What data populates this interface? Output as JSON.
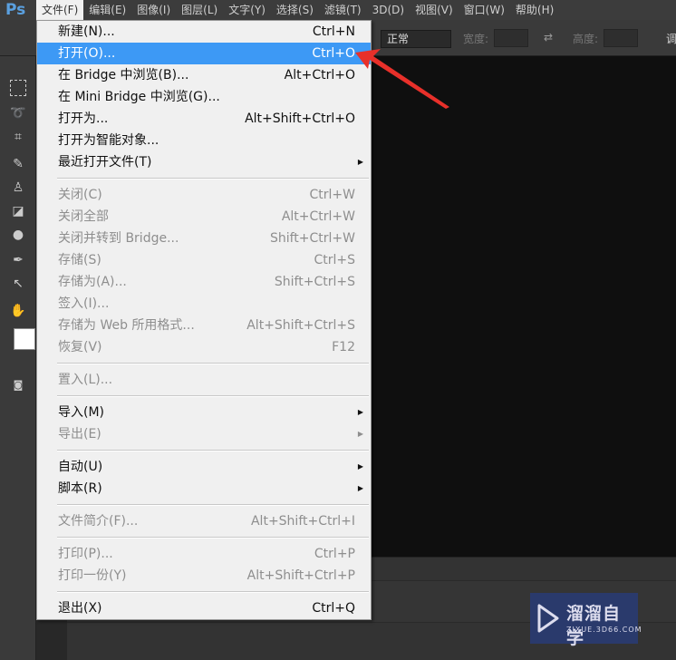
{
  "app_logo": "Ps",
  "menubar": [
    "文件(F)",
    "编辑(E)",
    "图像(I)",
    "图层(L)",
    "文字(Y)",
    "选择(S)",
    "滤镜(T)",
    "3D(D)",
    "视图(V)",
    "窗口(W)",
    "帮助(H)"
  ],
  "options": {
    "mode": "正常",
    "width_label": "宽度:",
    "height_label": "高度:",
    "trailing": "调"
  },
  "file_menu": [
    [
      {
        "label": "新建(N)...",
        "shortcut": "Ctrl+N"
      },
      {
        "label": "打开(O)...",
        "shortcut": "Ctrl+O",
        "highlighted": true
      },
      {
        "label": "在 Bridge 中浏览(B)...",
        "shortcut": "Alt+Ctrl+O"
      },
      {
        "label": "在 Mini Bridge 中浏览(G)..."
      },
      {
        "label": "打开为...",
        "shortcut": "Alt+Shift+Ctrl+O"
      },
      {
        "label": "打开为智能对象..."
      },
      {
        "label": "最近打开文件(T)",
        "submenu": true
      }
    ],
    [
      {
        "label": "关闭(C)",
        "shortcut": "Ctrl+W",
        "disabled": true
      },
      {
        "label": "关闭全部",
        "shortcut": "Alt+Ctrl+W",
        "disabled": true
      },
      {
        "label": "关闭并转到 Bridge...",
        "shortcut": "Shift+Ctrl+W",
        "disabled": true
      },
      {
        "label": "存储(S)",
        "shortcut": "Ctrl+S",
        "disabled": true
      },
      {
        "label": "存储为(A)...",
        "shortcut": "Shift+Ctrl+S",
        "disabled": true
      },
      {
        "label": "签入(I)...",
        "disabled": true
      },
      {
        "label": "存储为 Web 所用格式...",
        "shortcut": "Alt+Shift+Ctrl+S",
        "disabled": true
      },
      {
        "label": "恢复(V)",
        "shortcut": "F12",
        "disabled": true
      }
    ],
    [
      {
        "label": "置入(L)...",
        "disabled": true
      }
    ],
    [
      {
        "label": "导入(M)",
        "submenu": true
      },
      {
        "label": "导出(E)",
        "submenu": true,
        "disabled": true
      }
    ],
    [
      {
        "label": "自动(U)",
        "submenu": true
      },
      {
        "label": "脚本(R)",
        "submenu": true
      }
    ],
    [
      {
        "label": "文件简介(F)...",
        "shortcut": "Alt+Shift+Ctrl+I",
        "disabled": true
      }
    ],
    [
      {
        "label": "打印(P)...",
        "shortcut": "Ctrl+P",
        "disabled": true
      },
      {
        "label": "打印一份(Y)",
        "shortcut": "Alt+Shift+Ctrl+P",
        "disabled": true
      }
    ],
    [
      {
        "label": "退出(X)",
        "shortcut": "Ctrl+Q"
      }
    ]
  ],
  "watermark": {
    "title": "溜溜自学",
    "url": "ZIXUE.3D66.COM"
  },
  "colors": {
    "highlight": "#3d99f5",
    "arrow": "#e8302a"
  }
}
